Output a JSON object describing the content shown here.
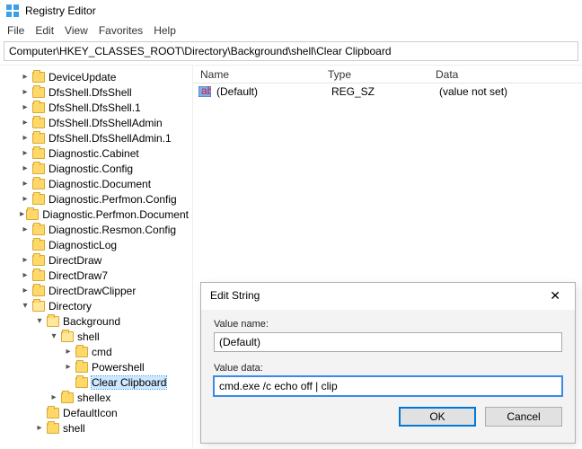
{
  "app": {
    "title": "Registry Editor",
    "address": "Computer\\HKEY_CLASSES_ROOT\\Directory\\Background\\shell\\Clear Clipboard"
  },
  "menu": {
    "file": "File",
    "edit": "Edit",
    "view": "View",
    "favorites": "Favorites",
    "help": "Help"
  },
  "tree": {
    "n0": "DeviceUpdate",
    "n1": "DfsShell.DfsShell",
    "n2": "DfsShell.DfsShell.1",
    "n3": "DfsShell.DfsShellAdmin",
    "n4": "DfsShell.DfsShellAdmin.1",
    "n5": "Diagnostic.Cabinet",
    "n6": "Diagnostic.Config",
    "n7": "Diagnostic.Document",
    "n8": "Diagnostic.Perfmon.Config",
    "n9": "Diagnostic.Perfmon.Document",
    "n10": "Diagnostic.Resmon.Config",
    "n11": "DiagnosticLog",
    "n12": "DirectDraw",
    "n13": "DirectDraw7",
    "n14": "DirectDrawClipper",
    "n15": "Directory",
    "n16": "Background",
    "n17": "shell",
    "n18": "cmd",
    "n19": "Powershell",
    "n20": "Clear Clipboard",
    "n21": "shellex",
    "n22": "DefaultIcon",
    "n23": "shell"
  },
  "list": {
    "headers": {
      "name": "Name",
      "type": "Type",
      "data": "Data"
    },
    "row0": {
      "name": "(Default)",
      "type": "REG_SZ",
      "data": "(value not set)"
    }
  },
  "dialog": {
    "title": "Edit String",
    "close": "✕",
    "value_name_label": "Value name:",
    "value_name": "(Default)",
    "value_data_label": "Value data:",
    "value_data": "cmd.exe /c echo off | clip",
    "ok": "OK",
    "cancel": "Cancel"
  }
}
